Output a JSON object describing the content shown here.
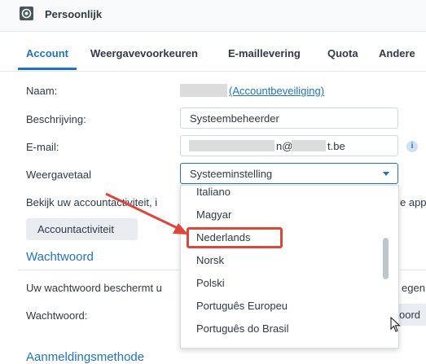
{
  "window": {
    "title": "Persoonlijk"
  },
  "tabs": [
    {
      "label": "Account",
      "active": true
    },
    {
      "label": "Weergavevoorkeuren"
    },
    {
      "label": "E-maillevering"
    },
    {
      "label": "Quota"
    },
    {
      "label": "Andere"
    }
  ],
  "form": {
    "name_label": "Naam:",
    "account_security_link": "(Accountbeveiliging)",
    "description_label": "Beschrijving:",
    "description_value": "Systeembeheerder",
    "email_label": "E-mail:",
    "email_visible_parts": [
      "n@",
      "t.be"
    ],
    "display_language_label": "Weergavetaal",
    "display_language_value": "Systeeminstelling"
  },
  "activity": {
    "text_start": "Bekijk uw accountactiviteit, i",
    "text_end": "e app",
    "button_label": "Accountactiviteit"
  },
  "password_section": {
    "title": "Wachtwoord",
    "text_start": "Uw wachtwoord beschermt u",
    "text_end": "egen",
    "password_label": "Wachtwoord:",
    "button_partial": "oord"
  },
  "login_section": {
    "title_partial": "Aanmeldingsmethode"
  },
  "dropdown": {
    "options": [
      "Italiano",
      "Magyar",
      "Nederlands",
      "Norsk",
      "Polski",
      "Português Europeu",
      "Português do Brasil"
    ],
    "highlighted": "Nederlands"
  },
  "colors": {
    "accent": "#1f73c6",
    "annotation": "#e0453a"
  },
  "icons": {
    "app": "settings-icon",
    "info": "info-icon",
    "caret": "chevron-down-icon",
    "cursor": "mouse-pointer-icon"
  }
}
